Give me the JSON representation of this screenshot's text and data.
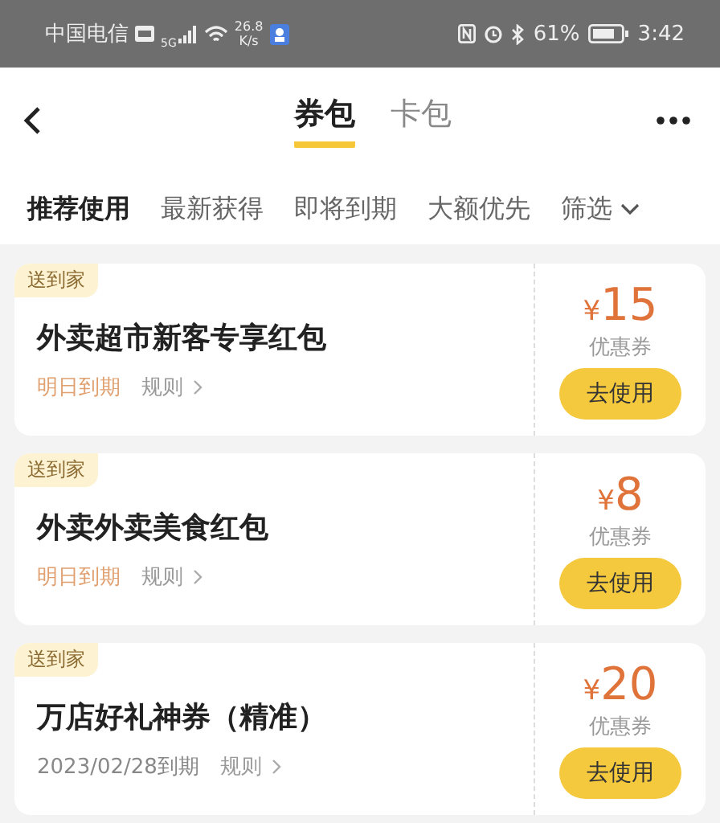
{
  "status_bar": {
    "carrier": "中国电信",
    "network": "5G",
    "speed_value": "26.8",
    "speed_unit": "K/s",
    "battery": "61%",
    "time": "3:42"
  },
  "nav": {
    "tabs": [
      {
        "label": "券包",
        "selected": true
      },
      {
        "label": "卡包",
        "selected": false
      }
    ]
  },
  "filters": [
    {
      "label": "推荐使用",
      "selected": true
    },
    {
      "label": "最新获得",
      "selected": false
    },
    {
      "label": "即将到期",
      "selected": false
    },
    {
      "label": "大额优先",
      "selected": false
    }
  ],
  "filter_menu": "筛选",
  "coupons": [
    {
      "tag": "送到家",
      "title": "外卖超市新客专享红包",
      "expiry": "明日到期",
      "urgent": true,
      "rules": "规则",
      "currency": "¥",
      "amount": "15",
      "type": "优惠券",
      "button": "去使用"
    },
    {
      "tag": "送到家",
      "title": "外卖外卖美食红包",
      "expiry": "明日到期",
      "urgent": true,
      "rules": "规则",
      "currency": "¥",
      "amount": "8",
      "type": "优惠券",
      "button": "去使用"
    },
    {
      "tag": "送到家",
      "title": "万店好礼神券（精准）",
      "expiry": "2023/02/28到期",
      "urgent": false,
      "rules": "规则",
      "currency": "¥",
      "amount": "20",
      "type": "优惠券",
      "button": "去使用"
    }
  ]
}
